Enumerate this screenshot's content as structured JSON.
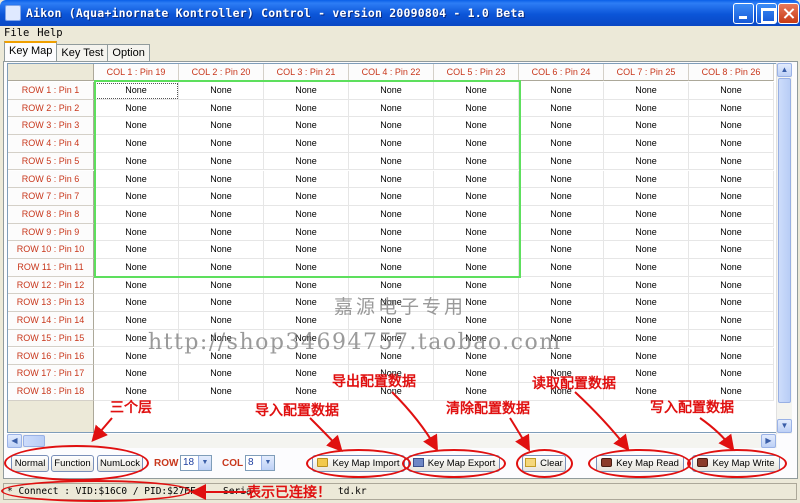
{
  "window": {
    "title": "Aikon (Aqua+inornate Kontroller) Control - version 20090804 - 1.0 Beta"
  },
  "menu": {
    "file": "File",
    "help": "Help"
  },
  "tabs": [
    "Key Map",
    "Key Test",
    "Option"
  ],
  "grid": {
    "columns": [
      "COL 1 : Pin 19",
      "COL 2 : Pin 20",
      "COL 3 : Pin 21",
      "COL 4 : Pin 22",
      "COL 5 : Pin 23",
      "COL 6 : Pin 24",
      "COL 7 : Pin 25",
      "COL 8 : Pin 26"
    ],
    "rows": [
      "ROW 1 : Pin 1",
      "ROW 2 : Pin 2",
      "ROW 3 : Pin 3",
      "ROW 4 : Pin 4",
      "ROW 5 : Pin 5",
      "ROW 6 : Pin 6",
      "ROW 7 : Pin 7",
      "ROW 8 : Pin 8",
      "ROW 9 : Pin 9",
      "ROW 10 : Pin 10",
      "ROW 11 : Pin 11",
      "ROW 12 : Pin 12",
      "ROW 13 : Pin 13",
      "ROW 14 : Pin 14",
      "ROW 15 : Pin 15",
      "ROW 16 : Pin 16",
      "ROW 17 : Pin 17",
      "ROW 18 : Pin 18"
    ],
    "cell_value": "None"
  },
  "toolbar": {
    "layers": [
      "Normal",
      "Function",
      "NumLock"
    ],
    "row_label": "ROW",
    "row_value": "18",
    "col_label": "COL",
    "col_value": "8",
    "import": "Key Map Import",
    "export": "Key Map Export",
    "clear": "Clear",
    "read": "Key Map Read",
    "write": "Key Map Write"
  },
  "status": {
    "text": "* Connect : VID:$16C0 / PID:$27EF",
    "tail": "Seria",
    "tail2": "td.kr"
  },
  "annotations": {
    "layers": "三个层",
    "import": "导入配置数据",
    "export": "导出配置数据",
    "clear": "清除配置数据",
    "read": "读取配置数据",
    "write": "写入配置数据",
    "connected": "表示已连接！",
    "color": "#e01010"
  },
  "watermark": {
    "line1": "嘉源电子专用",
    "line2": "http://shop34694757.taobao.com"
  }
}
